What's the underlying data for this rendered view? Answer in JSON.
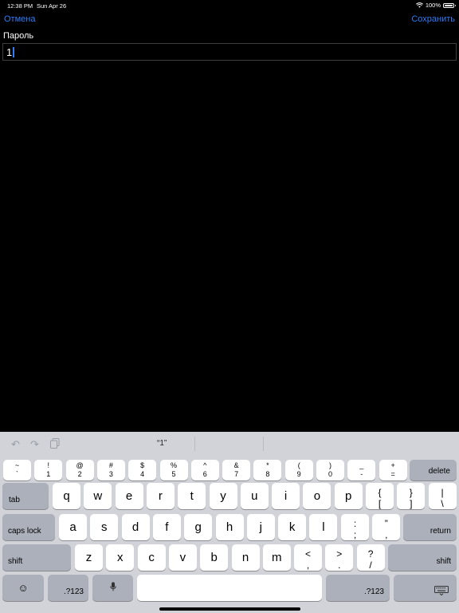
{
  "status": {
    "time": "12:38 PM",
    "date": "Sun Apr 26",
    "battery": "100%"
  },
  "nav": {
    "cancel": "Отмена",
    "save": "Сохранить"
  },
  "form": {
    "label": "Пароль",
    "value": "1"
  },
  "keyboard": {
    "suggestion": "“1”",
    "number_row": [
      {
        "top": "~",
        "bottom": "`"
      },
      {
        "top": "!",
        "bottom": "1"
      },
      {
        "top": "@",
        "bottom": "2"
      },
      {
        "top": "#",
        "bottom": "3"
      },
      {
        "top": "$",
        "bottom": "4"
      },
      {
        "top": "%",
        "bottom": "5"
      },
      {
        "top": "^",
        "bottom": "6"
      },
      {
        "top": "&",
        "bottom": "7"
      },
      {
        "top": "*",
        "bottom": "8"
      },
      {
        "top": "(",
        "bottom": "9"
      },
      {
        "top": ")",
        "bottom": "0"
      },
      {
        "top": "_",
        "bottom": "-"
      },
      {
        "top": "+",
        "bottom": "="
      }
    ],
    "delete": "delete",
    "tab": "tab",
    "row_q": [
      "q",
      "w",
      "e",
      "r",
      "t",
      "y",
      "u",
      "i",
      "o",
      "p"
    ],
    "row_q_sym": [
      {
        "top": "{",
        "bottom": "["
      },
      {
        "top": "}",
        "bottom": "]"
      },
      {
        "top": "|",
        "bottom": "\\"
      }
    ],
    "caps": "caps lock",
    "row_a": [
      "a",
      "s",
      "d",
      "f",
      "g",
      "h",
      "j",
      "k",
      "l"
    ],
    "row_a_sym": [
      {
        "top": ":",
        "bottom": ";"
      },
      {
        "top": "”",
        "bottom": ","
      }
    ],
    "return": "return",
    "shift": "shift",
    "row_z": [
      "z",
      "x",
      "c",
      "v",
      "b",
      "n",
      "m"
    ],
    "row_z_sym": [
      {
        "top": "<",
        "bottom": ","
      },
      {
        "top": ">",
        "bottom": "."
      },
      {
        "top": "?",
        "bottom": "/"
      }
    ],
    "emoji": "☺",
    "num_toggle": ".?123",
    "mic": "🎤",
    "hide": "⌨"
  }
}
